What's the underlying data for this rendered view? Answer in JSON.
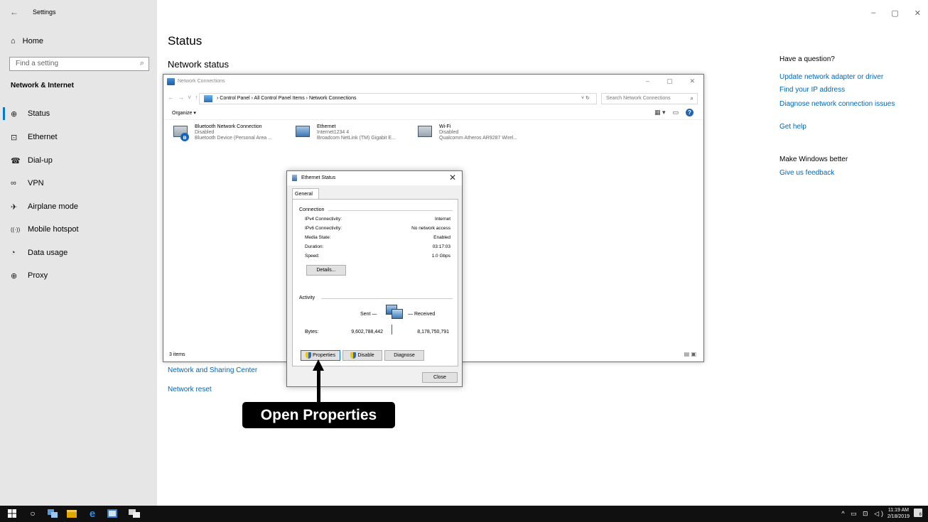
{
  "settings_window": {
    "title": "Settings",
    "back_glyph": "←",
    "window_controls": [
      "–",
      "▢",
      "✕"
    ]
  },
  "sidebar": {
    "home_label": "Home",
    "search_placeholder": "Find a setting",
    "section_title": "Network & Internet",
    "items": [
      {
        "label": "Status",
        "icon": "globe-icon",
        "glyph": "⊕",
        "active": true
      },
      {
        "label": "Ethernet",
        "icon": "ethernet-icon",
        "glyph": "⊡"
      },
      {
        "label": "Dial-up",
        "icon": "dialup-icon",
        "glyph": "☎"
      },
      {
        "label": "VPN",
        "icon": "vpn-icon",
        "glyph": "∞"
      },
      {
        "label": "Airplane mode",
        "icon": "airplane-icon",
        "glyph": "✈"
      },
      {
        "label": "Mobile hotspot",
        "icon": "hotspot-icon",
        "glyph": "((·))"
      },
      {
        "label": "Data usage",
        "icon": "data-usage-icon",
        "glyph": "◔"
      },
      {
        "label": "Proxy",
        "icon": "proxy-icon",
        "glyph": "⊕"
      }
    ]
  },
  "main": {
    "title": "Status",
    "subtitle": "Network status",
    "links": [
      "Network and Sharing Center",
      "Network reset"
    ]
  },
  "right_pane": {
    "question_heading": "Have a question?",
    "question_links": [
      "Update network adapter or driver",
      "Find your IP address",
      "Diagnose network connection issues",
      "Get help"
    ],
    "better_heading": "Make Windows better",
    "better_links": [
      "Give us feedback"
    ]
  },
  "network_connections": {
    "title": "Network Connections",
    "breadcrumb": "›  Control Panel  ›  All Control Panel Items  ›  Network Connections",
    "search_placeholder": "Search Network Connections",
    "organize_label": "Organize ▾",
    "item_count": "3 items",
    "adapters": [
      {
        "name": "Bluetooth Network Connection",
        "status": "Disabled",
        "device": "Bluetooth Device (Personal Area ..."
      },
      {
        "name": "Ethernet",
        "status": "Internet1234 4",
        "device": "Broadcom NetLink (TM) Gigabit E..."
      },
      {
        "name": "Wi-Fi",
        "status": "Disabled",
        "device": "Qualcomm Atheros AR9287 Wirel..."
      }
    ]
  },
  "ethernet_status": {
    "title": "Ethernet Status",
    "tab": "General",
    "connection_label": "Connection",
    "connection_rows": [
      {
        "key": "IPv4 Connectivity:",
        "value": "Internet"
      },
      {
        "key": "IPv6 Connectivity:",
        "value": "No network access"
      },
      {
        "key": "Media State:",
        "value": "Enabled"
      },
      {
        "key": "Duration:",
        "value": "03:17:03"
      },
      {
        "key": "Speed:",
        "value": "1.0 Gbps"
      }
    ],
    "details_button": "Details...",
    "activity_label": "Activity",
    "sent_label": "Sent —",
    "received_label": "— Received",
    "bytes_label": "Bytes:",
    "bytes_sent": "9,602,788,442",
    "bytes_received": "8,178,750,791",
    "properties_button": "Properties",
    "disable_button": "Disable",
    "diagnose_button": "Diagnose",
    "close_button": "Close"
  },
  "annotation": {
    "callout": "Open Properties"
  },
  "taskbar": {
    "time": "11:19 AM",
    "date": "2/18/2019",
    "tray_glyphs": "^ ▭ ⊡ ◁)",
    "notification_count": "6"
  }
}
